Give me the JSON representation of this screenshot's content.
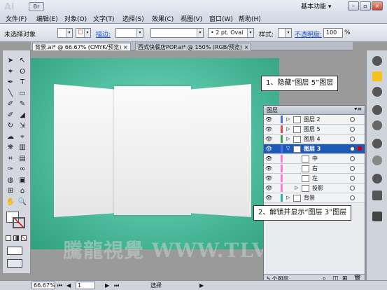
{
  "app": {
    "logo": "Ai",
    "bridge_label": "Br",
    "workspace": "基本功能 ▾"
  },
  "menu": [
    "文件(F)",
    "编辑(E)",
    "对象(O)",
    "文字(T)",
    "选择(S)",
    "效果(C)",
    "视图(V)",
    "窗口(W)",
    "帮助(H)"
  ],
  "window_buttons": [
    "–",
    "▫",
    "×"
  ],
  "control": {
    "selection_label": "未选择对象",
    "stroke_label": "描边:",
    "brush_value": "• 2 pt. Oval",
    "style_label": "样式:",
    "opacity_label": "不透明度:",
    "opacity_value": "100",
    "opacity_unit": "%"
  },
  "tabs": [
    {
      "label": "背景.ai* @ 66.67% (CMYK/预览)",
      "close": "×"
    },
    {
      "label": "西式快餐店POP.ai* @ 150% (RGB/预览)",
      "close": "×"
    }
  ],
  "tools_icons": [
    "selection-arrow",
    "direct-select",
    "magic-wand",
    "lasso",
    "pen",
    "type",
    "line",
    "rectangle",
    "paintbrush",
    "pencil",
    "blob-brush",
    "eraser",
    "rotate",
    "scale",
    "warp",
    "free-transform",
    "symbol-sprayer",
    "column-graph",
    "mesh",
    "gradient",
    "eyedropper",
    "blend",
    "live-paint",
    "live-paint-select",
    "crop",
    "slice",
    "hand",
    "zoom"
  ],
  "tools_glyphs": [
    "➤",
    "↖",
    "✶",
    "ʘ",
    "✒",
    "T",
    "╲",
    "▭",
    "✐",
    "✎",
    "✐",
    "◢",
    "↻",
    "⇲",
    "☁",
    "⌖",
    "❋",
    "▥",
    "⌗",
    "▤",
    "✑",
    "∞",
    "◍",
    "▣",
    "⊞",
    "⌂",
    "✋",
    "🔍"
  ],
  "layers_panel": {
    "title": "图层",
    "rows": [
      {
        "name": "图层 2",
        "color": "#4a6fe8",
        "level": 0,
        "expand": "▷",
        "active": false
      },
      {
        "name": "图层 5",
        "color": "#e04b4b",
        "level": 0,
        "expand": "▷",
        "active": false
      },
      {
        "name": "图层 4",
        "color": "#3aa64a",
        "level": 0,
        "expand": "▷",
        "active": false
      },
      {
        "name": "图层 3",
        "color": "#4a6fe8",
        "level": 0,
        "expand": "▽",
        "active": true
      },
      {
        "name": "中",
        "color": "#ff7ad9",
        "level": 1,
        "expand": "",
        "active": false
      },
      {
        "name": "右",
        "color": "#ff7ad9",
        "level": 1,
        "expand": "",
        "active": false
      },
      {
        "name": "左",
        "color": "#ff7ad9",
        "level": 1,
        "expand": "",
        "active": false
      },
      {
        "name": "投影",
        "color": "#ff7ad9",
        "level": 1,
        "expand": "▷",
        "active": false
      },
      {
        "name": "背景",
        "color": "#2fb3a6",
        "level": 0,
        "expand": "▷",
        "active": false
      }
    ],
    "footer": "5 个图层"
  },
  "callouts": [
    {
      "text": "1、隐藏“图层 5”图层"
    },
    {
      "text": "2、解锁并显示“图层 3”图层"
    }
  ],
  "watermark": "騰龍視覺 WWW.TLVI.NET",
  "status": {
    "zoom": "66.67%",
    "page": "1",
    "tool": "选择"
  },
  "colors": {
    "canvas": "#3fb391",
    "active_layer": "#1c5ab6",
    "pink": "#ff7ad9"
  }
}
